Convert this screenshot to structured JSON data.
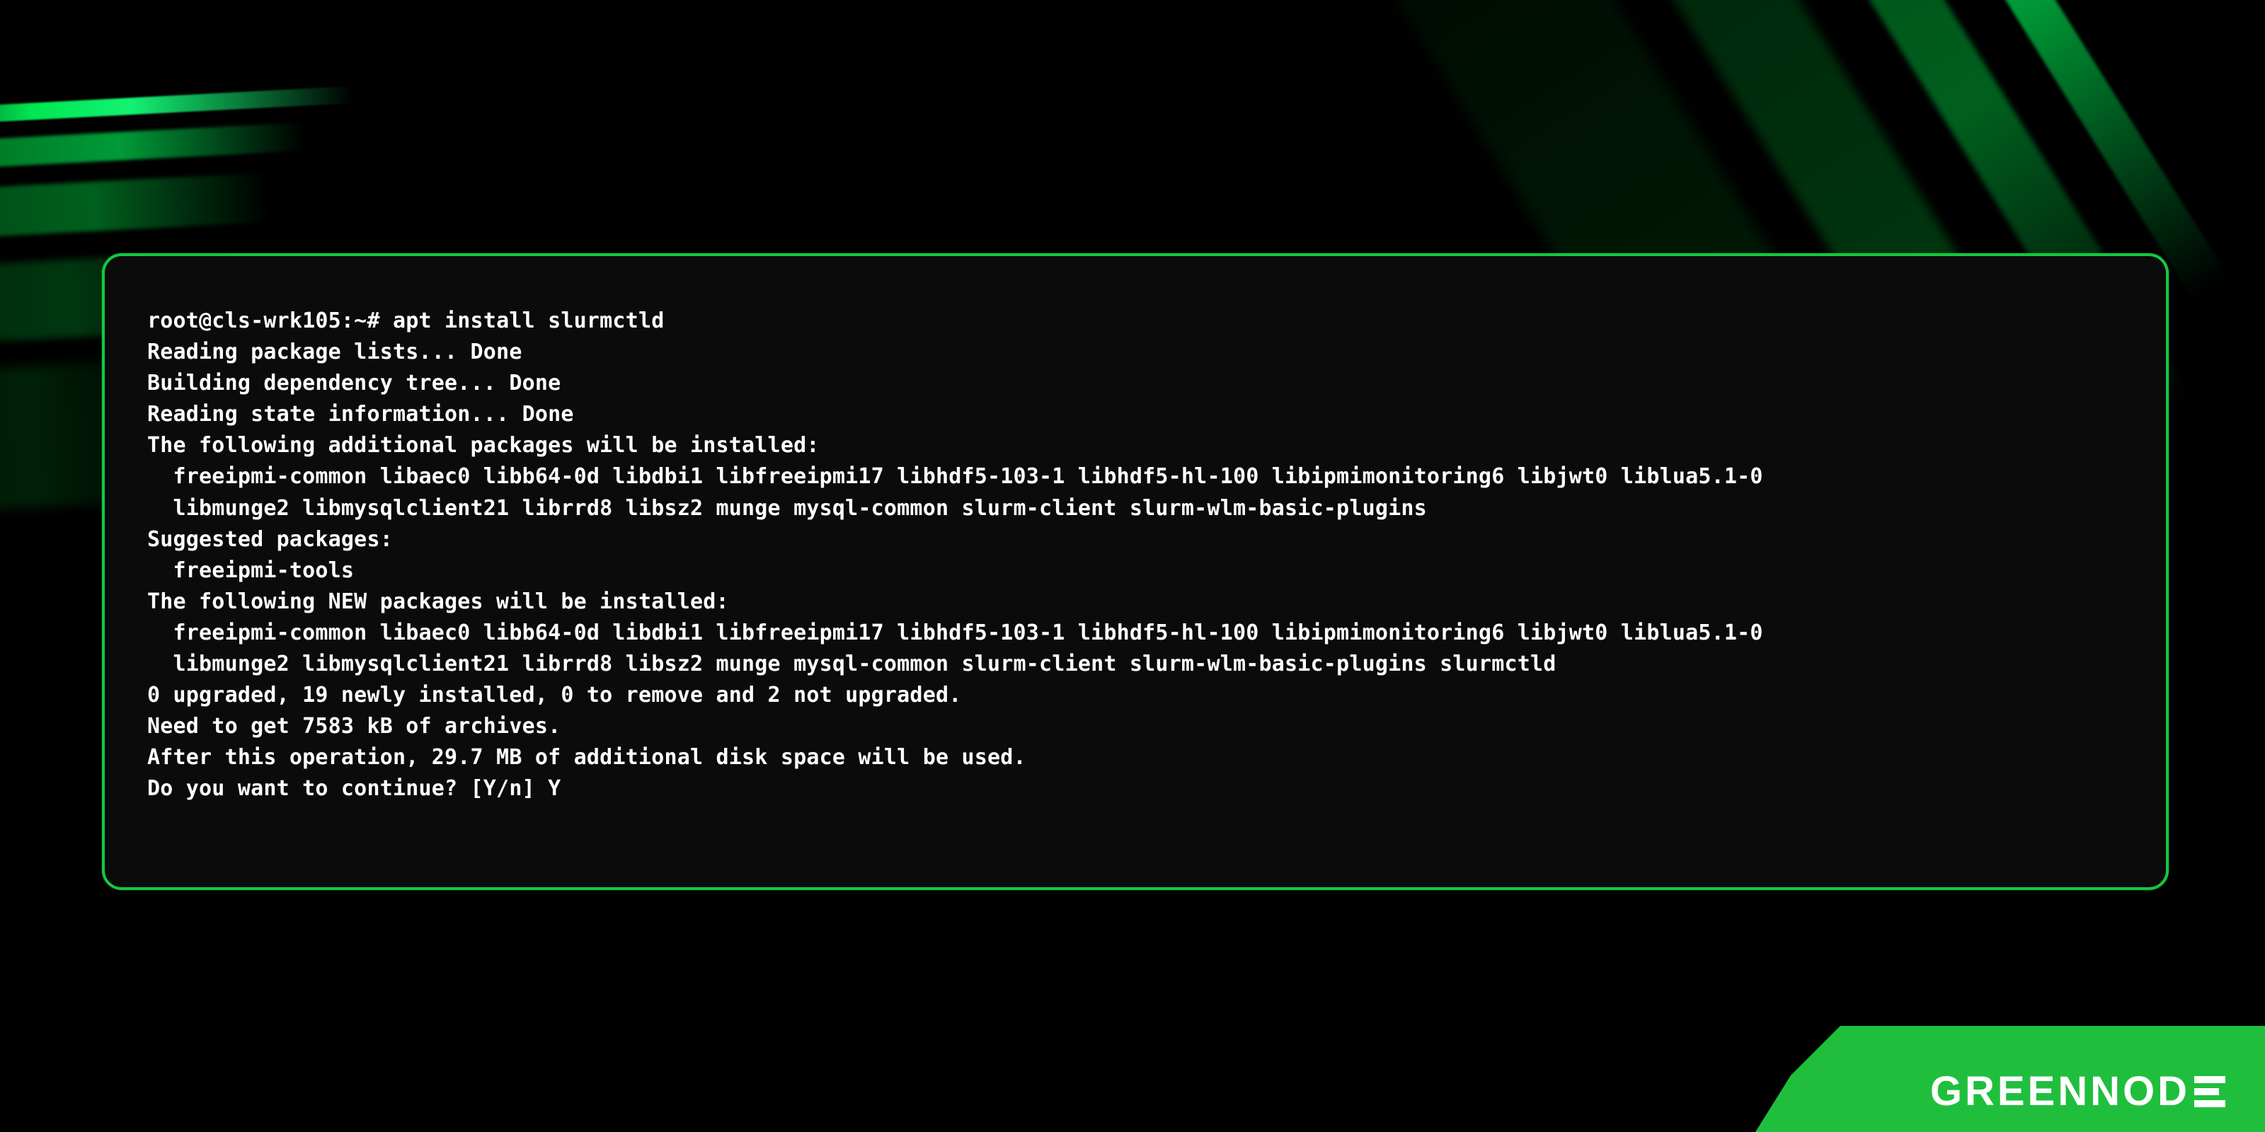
{
  "brand": {
    "name": "GREENNODE",
    "text_part": "GREENNOD"
  },
  "colors": {
    "accent": "#14c93f",
    "badge": "#1fbf3d",
    "terminal_bg": "#0b0b0b",
    "page_bg": "#000000",
    "text": "#ffffff"
  },
  "terminal": {
    "prompt": "root@cls-wrk105:~#",
    "command": "apt install slurmctld",
    "output_lines": [
      "Reading package lists... Done",
      "Building dependency tree... Done",
      "Reading state information... Done",
      "The following additional packages will be installed:",
      "  freeipmi-common libaec0 libb64-0d libdbi1 libfreeipmi17 libhdf5-103-1 libhdf5-hl-100 libipmimonitoring6 libjwt0 liblua5.1-0",
      "  libmunge2 libmysqlclient21 librrd8 libsz2 munge mysql-common slurm-client slurm-wlm-basic-plugins",
      "Suggested packages:",
      "  freeipmi-tools",
      "The following NEW packages will be installed:",
      "  freeipmi-common libaec0 libb64-0d libdbi1 libfreeipmi17 libhdf5-103-1 libhdf5-hl-100 libipmimonitoring6 libjwt0 liblua5.1-0",
      "  libmunge2 libmysqlclient21 librrd8 libsz2 munge mysql-common slurm-client slurm-wlm-basic-plugins slurmctld",
      "0 upgraded, 19 newly installed, 0 to remove and 2 not upgraded.",
      "Need to get 7583 kB of archives.",
      "After this operation, 29.7 MB of additional disk space will be used.",
      "Do you want to continue? [Y/n] Y"
    ]
  }
}
